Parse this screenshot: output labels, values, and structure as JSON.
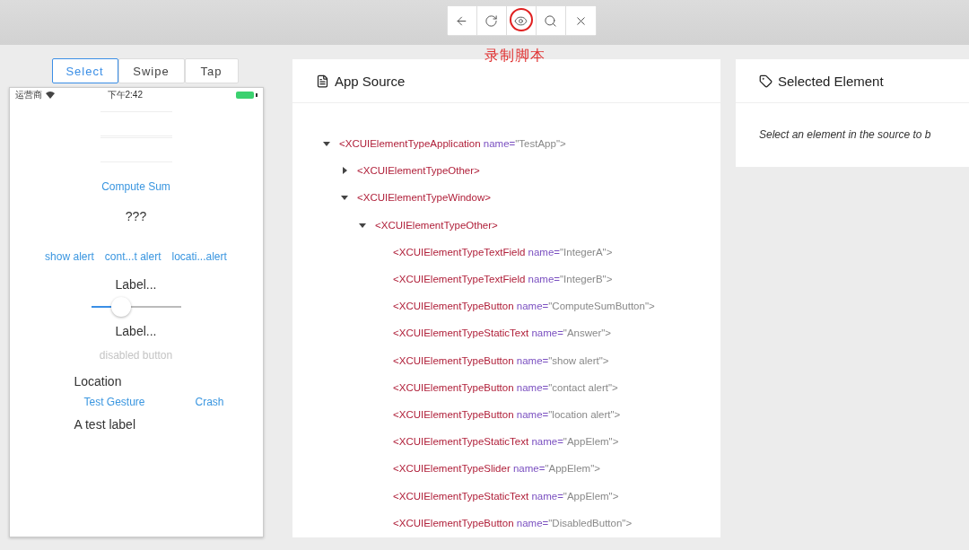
{
  "toolbar": {
    "buttons": [
      {
        "kind": "back",
        "highlighted": false
      },
      {
        "kind": "refresh",
        "highlighted": false
      },
      {
        "kind": "eye",
        "highlighted": true
      },
      {
        "kind": "search",
        "highlighted": false
      },
      {
        "kind": "close",
        "highlighted": false
      }
    ],
    "annotation": "录制脚本"
  },
  "modes": [
    {
      "label": "Select",
      "selected": true
    },
    {
      "label": "Swipe",
      "selected": false
    },
    {
      "label": "Tap",
      "selected": false
    }
  ],
  "phone": {
    "carrier": "运营商",
    "time": "下午2:42",
    "elements": [
      {
        "kind": "field"
      },
      {
        "kind": "field"
      },
      {
        "kind": "link",
        "text": "Compute Sum"
      },
      {
        "kind": "text",
        "text": "???"
      },
      {
        "kind": "links",
        "items": [
          "show alert",
          "cont...t alert",
          "locati...alert"
        ]
      },
      {
        "kind": "text",
        "text": "Label..."
      },
      {
        "kind": "slider",
        "level": 0.33
      },
      {
        "kind": "text",
        "text": "Label..."
      },
      {
        "kind": "disabled",
        "text": "disabled button"
      },
      {
        "kind": "left",
        "text": "Location"
      },
      {
        "kind": "links",
        "items": [
          "Test Gesture",
          "Crash"
        ]
      },
      {
        "kind": "left",
        "text": "A test label"
      }
    ]
  },
  "source": {
    "title": "App Source",
    "tree": [
      {
        "tag": "<XCUIElementTypeApplication",
        "attr": "name=",
        "value": "\"TestApp\">",
        "expanded": true,
        "children": [
          {
            "tag": "<XCUIElementTypeOther>",
            "expanded": false
          },
          {
            "tag": "<XCUIElementTypeWindow>",
            "expanded": true,
            "children": [
              {
                "tag": "<XCUIElementTypeOther>",
                "expanded": true,
                "children": [
                  {
                    "tag": "<XCUIElementTypeTextField",
                    "attr": "name=",
                    "value": "\"IntegerA\">"
                  },
                  {
                    "tag": "<XCUIElementTypeTextField",
                    "attr": "name=",
                    "value": "\"IntegerB\">"
                  },
                  {
                    "tag": "<XCUIElementTypeButton",
                    "attr": "name=",
                    "value": "\"ComputeSumButton\">"
                  },
                  {
                    "tag": "<XCUIElementTypeStaticText",
                    "attr": "name=",
                    "value": "\"Answer\">"
                  },
                  {
                    "tag": "<XCUIElementTypeButton",
                    "attr": "name=",
                    "value": "\"show alert\">"
                  },
                  {
                    "tag": "<XCUIElementTypeButton",
                    "attr": "name=",
                    "value": "\"contact alert\">"
                  },
                  {
                    "tag": "<XCUIElementTypeButton",
                    "attr": "name=",
                    "value": "\"location alert\">"
                  },
                  {
                    "tag": "<XCUIElementTypeStaticText",
                    "attr": "name=",
                    "value": "\"AppElem\">"
                  },
                  {
                    "tag": "<XCUIElementTypeSlider",
                    "attr": "name=",
                    "value": "\"AppElem\">"
                  },
                  {
                    "tag": "<XCUIElementTypeStaticText",
                    "attr": "name=",
                    "value": "\"AppElem\">"
                  },
                  {
                    "tag": "<XCUIElementTypeButton",
                    "attr": "name=",
                    "value": "\"DisabledButton\">"
                  }
                ]
              }
            ]
          }
        ]
      }
    ]
  },
  "selected": {
    "title": "Selected Element",
    "message": "Select an element in the source to b"
  }
}
